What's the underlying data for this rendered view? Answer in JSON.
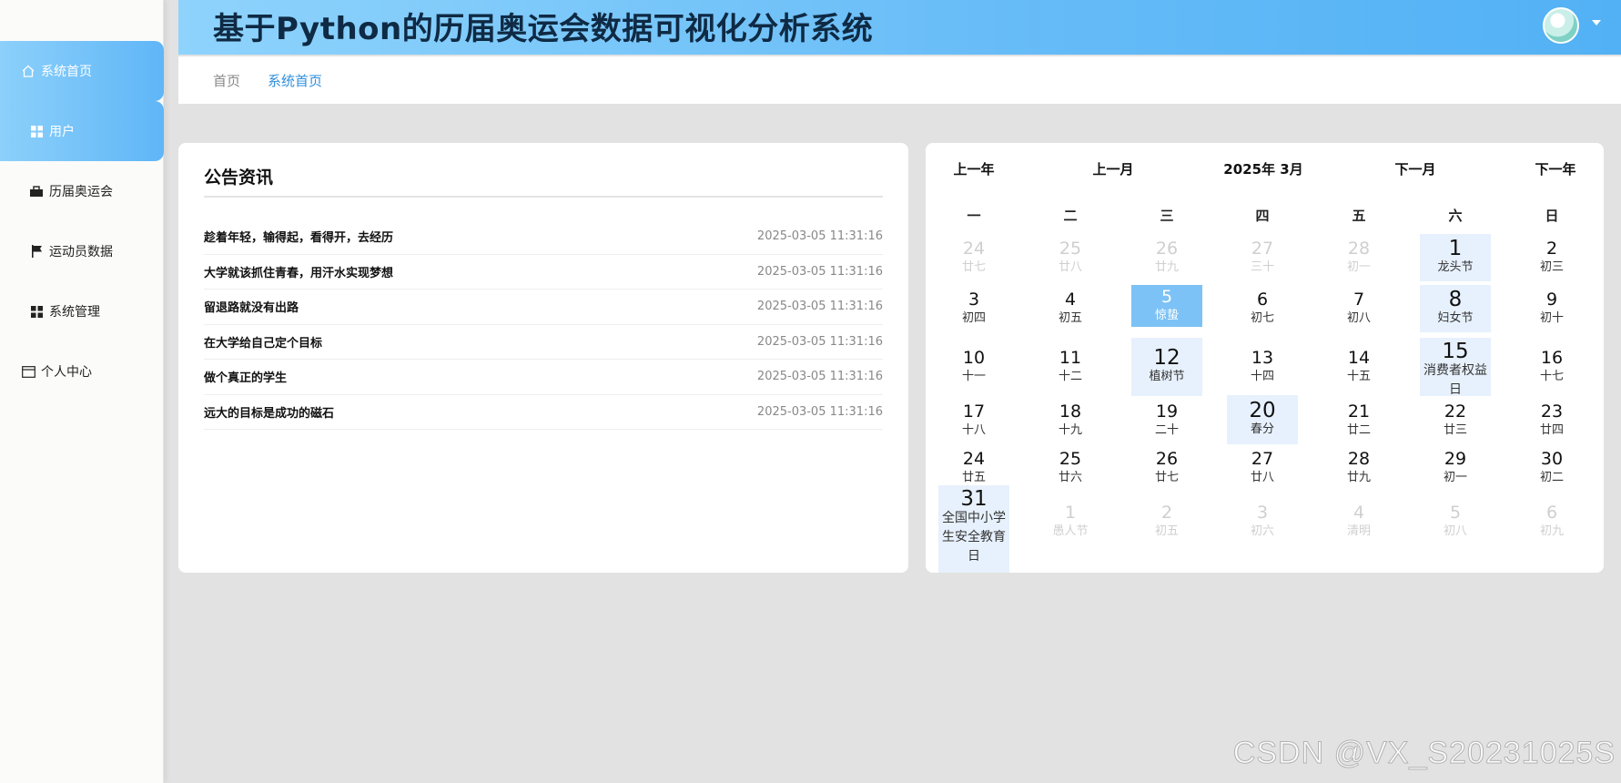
{
  "header": {
    "title": "基于Python的历届奥运会数据可视化分析系统"
  },
  "sidebar": {
    "items": [
      {
        "label": "系统首页",
        "icon": "home-icon"
      },
      {
        "label": "用户",
        "icon": "grid-icon"
      },
      {
        "label": "历届奥运会",
        "icon": "briefcase-icon"
      },
      {
        "label": "运动员数据",
        "icon": "flag-icon"
      },
      {
        "label": "系统管理",
        "icon": "grid-icon"
      },
      {
        "label": "个人中心",
        "icon": "card-icon"
      }
    ]
  },
  "breadcrumb": {
    "home": "首页",
    "current": "系统首页"
  },
  "notice": {
    "title": "公告资讯",
    "items": [
      {
        "title": "趁着年轻，输得起，看得开，去经历",
        "date": "2025-03-05 11:31:16"
      },
      {
        "title": "大学就该抓住青春，用汗水实现梦想",
        "date": "2025-03-05 11:31:16"
      },
      {
        "title": "留退路就没有出路",
        "date": "2025-03-05 11:31:16"
      },
      {
        "title": "在大学给自己定个目标",
        "date": "2025-03-05 11:31:16"
      },
      {
        "title": "做个真正的学生",
        "date": "2025-03-05 11:31:16"
      },
      {
        "title": "远大的目标是成功的磁石",
        "date": "2025-03-05 11:31:16"
      }
    ]
  },
  "calendar": {
    "prev_year": "上一年",
    "prev_month": "上一月",
    "current": "2025年 3月",
    "next_month": "下一月",
    "next_year": "下一年",
    "weekdays": [
      "一",
      "二",
      "三",
      "四",
      "五",
      "六",
      "日"
    ],
    "weeks": [
      [
        {
          "n": "24",
          "l": "廿七",
          "dim": true
        },
        {
          "n": "25",
          "l": "廿八",
          "dim": true
        },
        {
          "n": "26",
          "l": "廿九",
          "dim": true
        },
        {
          "n": "27",
          "l": "三十",
          "dim": true
        },
        {
          "n": "28",
          "l": "初一",
          "dim": true
        },
        {
          "n": "1",
          "l": "龙头节",
          "hl": true
        },
        {
          "n": "2",
          "l": "初三"
        }
      ],
      [
        {
          "n": "3",
          "l": "初四"
        },
        {
          "n": "4",
          "l": "初五"
        },
        {
          "n": "5",
          "l": "惊蛰",
          "today": true
        },
        {
          "n": "6",
          "l": "初七"
        },
        {
          "n": "7",
          "l": "初八"
        },
        {
          "n": "8",
          "l": "妇女节",
          "hl": true
        },
        {
          "n": "9",
          "l": "初十"
        }
      ],
      [
        {
          "n": "10",
          "l": "十一"
        },
        {
          "n": "11",
          "l": "十二"
        },
        {
          "n": "12",
          "l": "植树节",
          "hl": true
        },
        {
          "n": "13",
          "l": "十四"
        },
        {
          "n": "14",
          "l": "十五"
        },
        {
          "n": "15",
          "l": "消费者权益日",
          "hl": true
        },
        {
          "n": "16",
          "l": "十七"
        }
      ],
      [
        {
          "n": "17",
          "l": "十八"
        },
        {
          "n": "18",
          "l": "十九"
        },
        {
          "n": "19",
          "l": "二十"
        },
        {
          "n": "20",
          "l": "春分",
          "hl": true
        },
        {
          "n": "21",
          "l": "廿二"
        },
        {
          "n": "22",
          "l": "廿三"
        },
        {
          "n": "23",
          "l": "廿四"
        }
      ],
      [
        {
          "n": "24",
          "l": "廿五"
        },
        {
          "n": "25",
          "l": "廿六"
        },
        {
          "n": "26",
          "l": "廿七"
        },
        {
          "n": "27",
          "l": "廿八"
        },
        {
          "n": "28",
          "l": "廿九"
        },
        {
          "n": "29",
          "l": "初一"
        },
        {
          "n": "30",
          "l": "初二"
        }
      ],
      [
        {
          "n": "31",
          "l": "全国中小学生安全教育日",
          "hl": true
        },
        {
          "n": "1",
          "l": "愚人节",
          "dim": true
        },
        {
          "n": "2",
          "l": "初五",
          "dim": true
        },
        {
          "n": "3",
          "l": "初六",
          "dim": true
        },
        {
          "n": "4",
          "l": "清明",
          "dim": true
        },
        {
          "n": "5",
          "l": "初八",
          "dim": true
        },
        {
          "n": "6",
          "l": "初九",
          "dim": true
        }
      ]
    ]
  },
  "watermark": "CSDN @VX_S20231025S"
}
